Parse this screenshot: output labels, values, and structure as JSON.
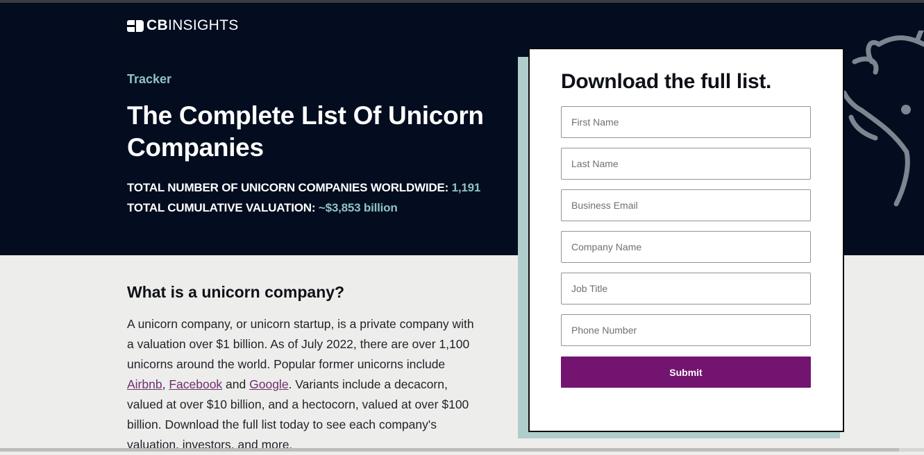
{
  "brand": {
    "logo_bold": "CB",
    "logo_light": "INSIGHTS"
  },
  "hero": {
    "eyebrow": "Tracker",
    "title": "The Complete List Of Unicorn Companies",
    "stats": [
      {
        "label": "TOTAL NUMBER OF UNICORN COMPANIES WORLDWIDE:",
        "value": "1,191"
      },
      {
        "label": "TOTAL CUMULATIVE VALUATION:",
        "value": "~$3,853 billion"
      }
    ]
  },
  "section": {
    "heading": "What is a unicorn company?",
    "text_1": "A unicorn company, or unicorn startup, is a private company with a valuation over $1 billion. As of July 2022, there are over 1,100 unicorns around the world. Popular former unicorns include ",
    "link_airbnb": "Airbnb",
    "sep_1": ", ",
    "link_facebook": "Facebook",
    "sep_2": " and ",
    "link_google": "Google",
    "text_2": ". Variants include a decacorn, valued at over $10 billion, and a hectocorn, valued at over $100 billion. Download the full list today to see each company's valuation, investors, and more."
  },
  "form": {
    "title": "Download the full list.",
    "fields": {
      "first_name": "First Name",
      "last_name": "Last Name",
      "business_email": "Business Email",
      "company_name": "Company Name",
      "job_title": "Job Title",
      "phone_number": "Phone Number"
    },
    "submit_label": "Submit"
  },
  "colors": {
    "hero_bg": "#040d1f",
    "accent_teal": "#8ec3c3",
    "submit_purple": "#731470",
    "card_shadow": "#aecdcc",
    "link": "#6e2e6e"
  },
  "icons": [
    "logo-mark-icon",
    "unicorn-illustration"
  ]
}
